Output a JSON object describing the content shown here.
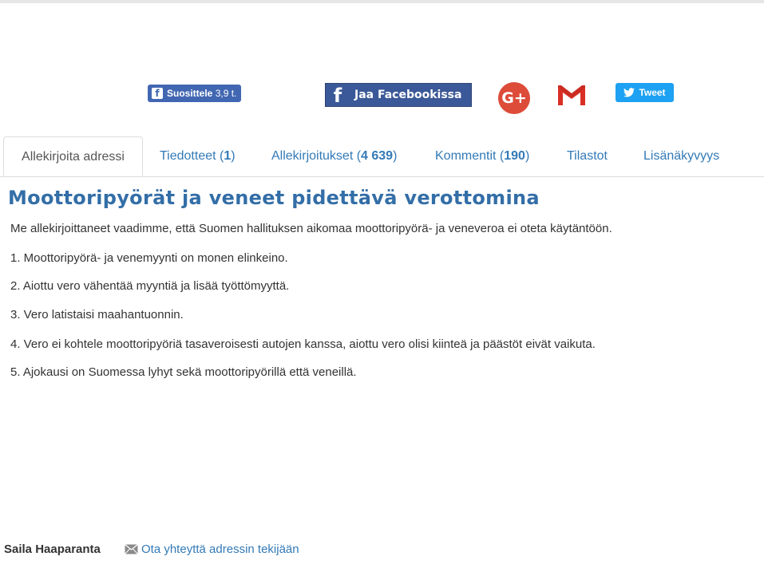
{
  "share": {
    "recommend_label": "Suosittele",
    "recommend_count": "3,9 t.",
    "facebook_share_label": "Jaa Facebookissa",
    "tweet_label": "Tweet",
    "gplus_label": "G+"
  },
  "tabs": [
    {
      "label": "Allekirjoita adressi",
      "count": ""
    },
    {
      "label": "Tiedotteet (",
      "count": "1",
      "suffix": ")"
    },
    {
      "label": "Allekirjoitukset (",
      "count": "4 639",
      "suffix": ")"
    },
    {
      "label": "Kommentit (",
      "count": "190",
      "suffix": ")"
    },
    {
      "label": "Tilastot",
      "count": ""
    },
    {
      "label": "Lisänäkyvyys",
      "count": ""
    }
  ],
  "petition": {
    "title": "Moottoripyörät ja veneet pidettävä verottomina",
    "intro": "Me allekirjoittaneet vaadimme, että Suomen hallituksen aikomaa moottoripyörä- ja veneveroa ei oteta käytäntöön.",
    "points": [
      "1. Moottoripyörä- ja venemyynti on monen elinkeino.",
      "2. Aiottu vero vähentää myyntiä ja lisää työttömyyttä.",
      "3. Vero latistaisi maahantuonnin.",
      "4. Vero ei kohtele moottoripyöriä tasaveroisesti autojen kanssa, aiottu vero olisi kiinteä ja päästöt eivät vaikuta.",
      "5. Ajokausi on Suomessa lyhyt sekä moottoripyörillä että veneillä."
    ]
  },
  "footer": {
    "author": "Saila Haaparanta",
    "contact_label": "Ota yhteyttä adressin tekijään"
  },
  "colors": {
    "link": "#337ab7",
    "title": "#336ea7",
    "facebook": "#3b5998",
    "twitter": "#1da1f2",
    "gplus": "#dd4b39",
    "gmail": "#d93025"
  }
}
